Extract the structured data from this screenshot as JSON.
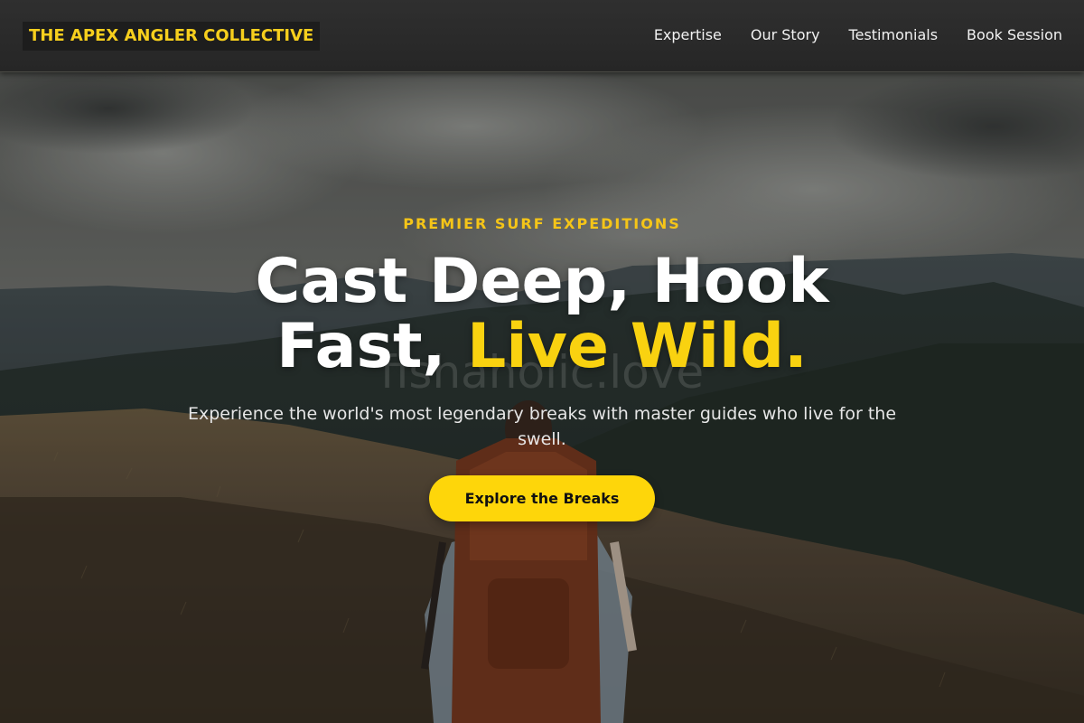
{
  "header": {
    "logo_text": "THE APEX ANGLER COLLECTIVE",
    "nav": [
      {
        "label": "Expertise"
      },
      {
        "label": "Our Story"
      },
      {
        "label": "Testimonials"
      },
      {
        "label": "Book Session"
      }
    ]
  },
  "hero": {
    "eyebrow": "PREMIER SURF EXPEDITIONS",
    "headline_part1": "Cast Deep, Hook",
    "headline_part2": "Fast, ",
    "headline_accent": "Live Wild.",
    "watermark": "fishaholic.love",
    "subtitle": "Experience the world's most legendary breaks with master guides who live for the swell.",
    "cta_label": "Explore the Breaks"
  },
  "colors": {
    "accent": "#f9d210",
    "header_bg": "#2b2b2b",
    "button_bg": "#fed60a"
  }
}
